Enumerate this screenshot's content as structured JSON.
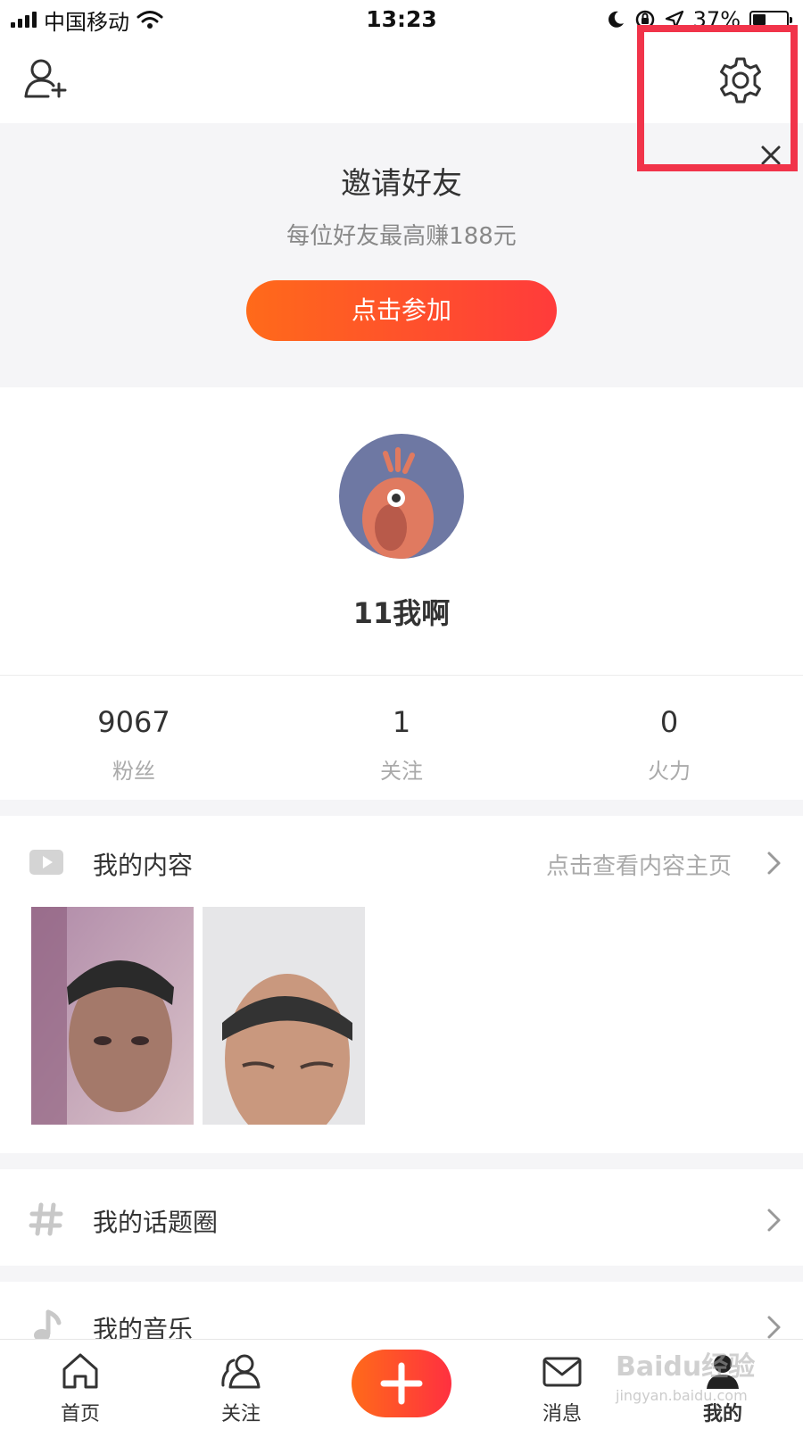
{
  "status_bar": {
    "carrier": "中国移动",
    "time": "13:23",
    "battery": "37%"
  },
  "invite": {
    "title": "邀请好友",
    "subtitle": "每位好友最高赚188元",
    "button_label": "点击参加",
    "close": "×"
  },
  "profile": {
    "username": "11我啊"
  },
  "stats": [
    {
      "value": "9067",
      "label": "粉丝"
    },
    {
      "value": "1",
      "label": "关注"
    },
    {
      "value": "0",
      "label": "火力"
    }
  ],
  "my_content": {
    "label": "我的内容",
    "hint": "点击查看内容主页"
  },
  "rows": {
    "topic_circle": "我的话题圈",
    "music": "我的音乐"
  },
  "tabs": [
    {
      "label": "首页",
      "icon": "home-icon"
    },
    {
      "label": "关注",
      "icon": "people-icon"
    },
    {
      "label": "消息",
      "icon": "mail-icon"
    },
    {
      "label": "我的",
      "icon": "profile-icon"
    }
  ],
  "watermark": {
    "text": "Baidu经验",
    "sub": "jingyan.baidu.com"
  },
  "colors": {
    "accent_start": "#ff6a1a",
    "accent_end": "#ff3b3b",
    "annotation": "#f1344a"
  }
}
